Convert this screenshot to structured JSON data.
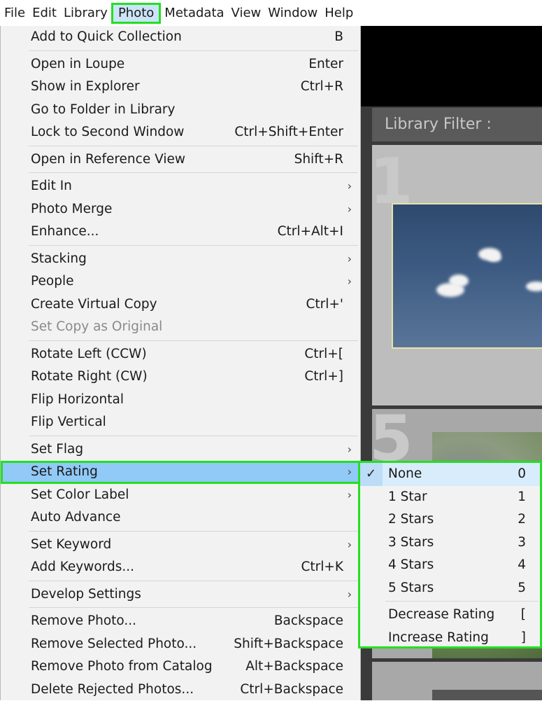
{
  "menubar": {
    "items": [
      {
        "label": "File"
      },
      {
        "label": "Edit"
      },
      {
        "label": "Library"
      },
      {
        "label": "Photo"
      },
      {
        "label": "Metadata"
      },
      {
        "label": "View"
      },
      {
        "label": "Window"
      },
      {
        "label": "Help"
      }
    ],
    "active_index": 3
  },
  "background": {
    "filter_label": "Library Filter :",
    "grid_numbers": [
      "1",
      "5"
    ]
  },
  "photo_menu": {
    "items": [
      {
        "label": "Add to Quick Collection",
        "shortcut": "B"
      },
      {
        "label": "Open in Loupe",
        "shortcut": "Enter"
      },
      {
        "label": "Show in Explorer",
        "shortcut": "Ctrl+R"
      },
      {
        "label": "Go to Folder in Library",
        "shortcut": ""
      },
      {
        "label": "Lock to Second Window",
        "shortcut": "Ctrl+Shift+Enter"
      },
      {
        "label": "Open in Reference View",
        "shortcut": "Shift+R"
      },
      {
        "label": "Edit In",
        "submenu": true
      },
      {
        "label": "Photo Merge",
        "submenu": true
      },
      {
        "label": "Enhance...",
        "shortcut": "Ctrl+Alt+I"
      },
      {
        "label": "Stacking",
        "submenu": true
      },
      {
        "label": "People",
        "submenu": true
      },
      {
        "label": "Create Virtual Copy",
        "shortcut": "Ctrl+'"
      },
      {
        "label": "Set Copy as Original",
        "shortcut": "",
        "disabled": true
      },
      {
        "label": "Rotate Left (CCW)",
        "shortcut": "Ctrl+["
      },
      {
        "label": "Rotate Right (CW)",
        "shortcut": "Ctrl+]"
      },
      {
        "label": "Flip Horizontal",
        "shortcut": ""
      },
      {
        "label": "Flip Vertical",
        "shortcut": ""
      },
      {
        "label": "Set Flag",
        "submenu": true
      },
      {
        "label": "Set Rating",
        "submenu": true,
        "highlighted": true
      },
      {
        "label": "Set Color Label",
        "submenu": true
      },
      {
        "label": "Auto Advance",
        "shortcut": ""
      },
      {
        "label": "Set Keyword",
        "submenu": true
      },
      {
        "label": "Add Keywords...",
        "shortcut": "Ctrl+K"
      },
      {
        "label": "Develop Settings",
        "submenu": true
      },
      {
        "label": "Remove Photo...",
        "shortcut": "Backspace"
      },
      {
        "label": "Remove Selected Photo...",
        "shortcut": "Shift+Backspace"
      },
      {
        "label": "Remove Photo from Catalog",
        "shortcut": "Alt+Backspace"
      },
      {
        "label": "Delete Rejected Photos...",
        "shortcut": "Ctrl+Backspace"
      }
    ],
    "submenu_arrow": "›"
  },
  "rating_submenu": {
    "check_glyph": "✓",
    "items": [
      {
        "label": "None",
        "shortcut": "0",
        "checked": true
      },
      {
        "label": "1 Star",
        "shortcut": "1"
      },
      {
        "label": "2 Stars",
        "shortcut": "2"
      },
      {
        "label": "3 Stars",
        "shortcut": "3"
      },
      {
        "label": "4 Stars",
        "shortcut": "4"
      },
      {
        "label": "5 Stars",
        "shortcut": "5"
      },
      {
        "label": "Decrease Rating",
        "shortcut": "["
      },
      {
        "label": "Increase Rating",
        "shortcut": "]"
      }
    ]
  },
  "colors": {
    "highlight_blue": "#91c9f7",
    "annotation_green": "#22e022",
    "menu_bg": "#f2f2f2"
  }
}
